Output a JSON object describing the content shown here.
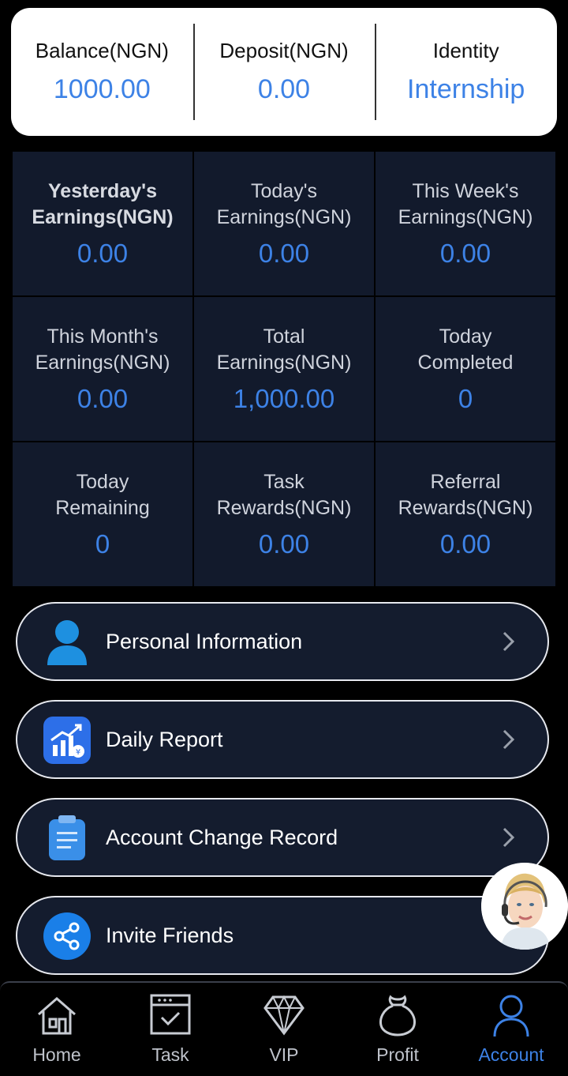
{
  "summary": [
    {
      "label": "Balance(NGN)",
      "value": "1000.00"
    },
    {
      "label": "Deposit(NGN)",
      "value": "0.00"
    },
    {
      "label": "Identity",
      "value": "Internship"
    }
  ],
  "stats": [
    {
      "line1": "Yesterday's",
      "line2": "Earnings(NGN)",
      "value": "0.00"
    },
    {
      "line1": "Today's",
      "line2": "Earnings(NGN)",
      "value": "0.00"
    },
    {
      "line1": "This Week's",
      "line2": "Earnings(NGN)",
      "value": "0.00"
    },
    {
      "line1": "This Month's",
      "line2": "Earnings(NGN)",
      "value": "0.00"
    },
    {
      "line1": "Total",
      "line2": "Earnings(NGN)",
      "value": "1,000.00"
    },
    {
      "line1": "Today",
      "line2": "Completed",
      "value": "0"
    },
    {
      "line1": "Today",
      "line2": "Remaining",
      "value": "0"
    },
    {
      "line1": "Task",
      "line2": "Rewards(NGN)",
      "value": "0.00"
    },
    {
      "line1": "Referral",
      "line2": "Rewards(NGN)",
      "value": "0.00"
    }
  ],
  "menu": [
    {
      "label": "Personal Information",
      "icon": "user-icon"
    },
    {
      "label": "Daily Report",
      "icon": "report-chart-icon"
    },
    {
      "label": "Account Change Record",
      "icon": "clipboard-icon"
    },
    {
      "label": "Invite Friends",
      "icon": "share-icon"
    }
  ],
  "tabs": [
    {
      "label": "Home",
      "icon": "home-icon"
    },
    {
      "label": "Task",
      "icon": "task-calendar-icon"
    },
    {
      "label": "VIP",
      "icon": "diamond-icon"
    },
    {
      "label": "Profit",
      "icon": "money-bag-icon"
    },
    {
      "label": "Account",
      "icon": "account-person-icon",
      "active": true
    }
  ],
  "colors": {
    "accent": "#3d82e6",
    "panel": "#121a2c",
    "background": "#000000"
  }
}
